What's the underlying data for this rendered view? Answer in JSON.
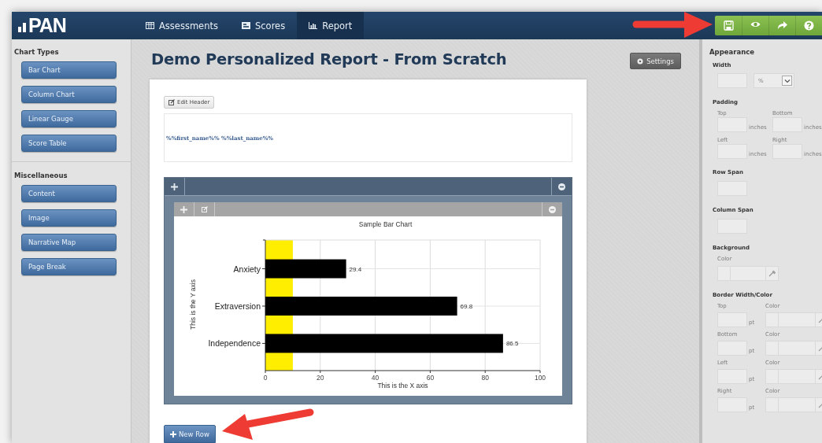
{
  "logo": {
    "text": "PAN"
  },
  "nav_tabs": [
    {
      "label": "Assessments",
      "selected": false
    },
    {
      "label": "Scores",
      "selected": false
    },
    {
      "label": "Report",
      "selected": true
    }
  ],
  "sidebar": {
    "sections": [
      {
        "heading": "Chart Types",
        "items": [
          "Bar Chart",
          "Column Chart",
          "Linear Gauge",
          "Score Table"
        ]
      },
      {
        "heading": "Miscellaneous",
        "items": [
          "Content",
          "Image",
          "Narrative Map",
          "Page Break"
        ]
      }
    ]
  },
  "page": {
    "title": "Demo Personalized Report - From Scratch",
    "settings_button": "Settings",
    "edit_header_button": "Edit Header",
    "header_text": "%%first_name%% %%last_name%%",
    "chart_data": {
      "type": "bar",
      "orientation": "horizontal",
      "title": "Sample Bar Chart",
      "xlabel": "This is the X axis",
      "ylabel": "This is the Y axis",
      "categories": [
        "Anxiety",
        "Extraversion",
        "Independence"
      ],
      "values": [
        29.4,
        69.8,
        86.5
      ],
      "xlim": [
        0,
        100
      ],
      "xticks": [
        0,
        20,
        40,
        60,
        80,
        100
      ],
      "data_labels": true,
      "grid": true,
      "bands": [
        {
          "axis": "x",
          "from": 0,
          "to": 10,
          "color": "#ffee00"
        }
      ]
    },
    "new_row_button": "New Row"
  },
  "appearance_panel": {
    "title": "Appearance",
    "width": {
      "label": "Width",
      "unit": "%"
    },
    "padding": {
      "label": "Padding",
      "fields": [
        {
          "label": "Top",
          "unit": "inches"
        },
        {
          "label": "Bottom",
          "unit": "inches"
        },
        {
          "label": "Left",
          "unit": "inches"
        },
        {
          "label": "Right",
          "unit": "inches"
        }
      ]
    },
    "row_span": {
      "label": "Row Span"
    },
    "column_span": {
      "label": "Column Span"
    },
    "background": {
      "label": "Background",
      "color_label": "Color"
    },
    "border": {
      "label": "Border Width/Color",
      "fields": [
        {
          "label": "Top",
          "unit": "pt",
          "color_label": "Color"
        },
        {
          "label": "Bottom",
          "unit": "pt",
          "color_label": "Color"
        },
        {
          "label": "Left",
          "unit": "pt",
          "color_label": "Color"
        },
        {
          "label": "Right",
          "unit": "pt",
          "color_label": "Color"
        }
      ]
    }
  }
}
